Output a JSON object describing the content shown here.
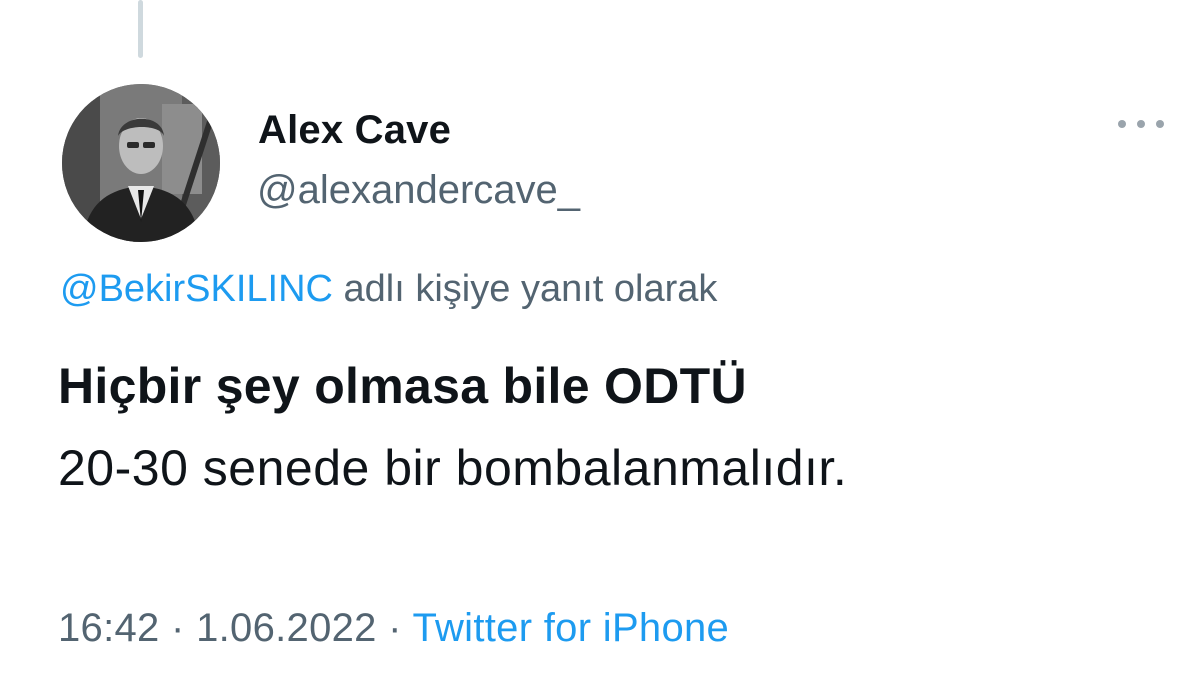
{
  "tweet": {
    "author": {
      "display_name": "Alex Cave",
      "handle": "@alexandercave_"
    },
    "reply_to": {
      "mention": "@BekirSKILINC",
      "suffix": " adlı kişiye yanıt olarak"
    },
    "text_line1": "Hiçbir şey olmasa bile ODTÜ",
    "text_line2": "20-30 senede bir bombalanmalıdır.",
    "time": "16:42",
    "separator": " · ",
    "date": "1.06.2022",
    "source": "Twitter for iPhone"
  },
  "icons": {
    "more": "more-horizontal-icon"
  },
  "colors": {
    "link": "#1d9bf0",
    "secondary_text": "#536471",
    "primary_text": "#0f1419"
  }
}
